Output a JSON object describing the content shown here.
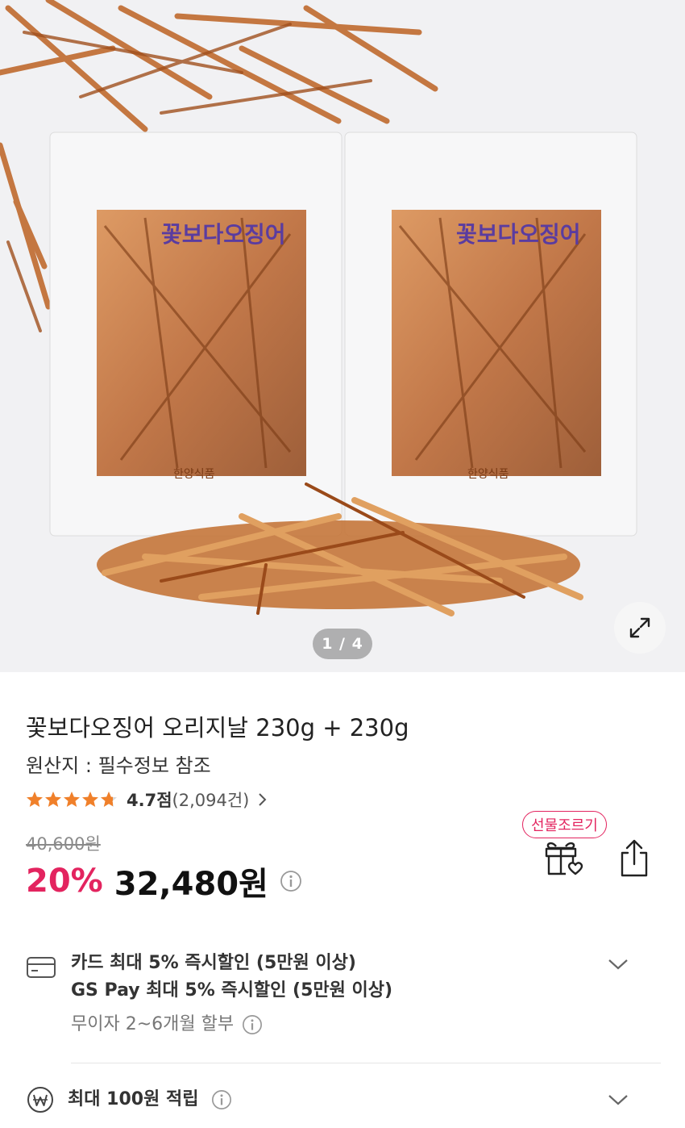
{
  "gallery": {
    "counter": "1 / 4",
    "expand_icon": "expand-arrows-icon",
    "package_brand": "꽃보다오징어",
    "package_maker": "한양식품"
  },
  "product": {
    "title": "꽃보다오징어 오리지날 230g + 230g",
    "origin": "원산지 : 필수정보 참조",
    "rating_score": 4.7,
    "rating_label": "4.7점",
    "review_count": "(2,094건)",
    "original_price": "40,600원",
    "discount": "20%",
    "price": "32,480원",
    "gift_badge": "선물조르기"
  },
  "benefits": {
    "card_line1": "카드 최대 5% 즉시할인 (5만원 이상)",
    "card_line2": "GS Pay 최대 5% 즉시할인 (5만원 이상)",
    "installment": "무이자 2~6개월 할부",
    "points": "최대 100원 적립"
  },
  "colors": {
    "accent": "#e3245f",
    "star": "#f0802a"
  }
}
